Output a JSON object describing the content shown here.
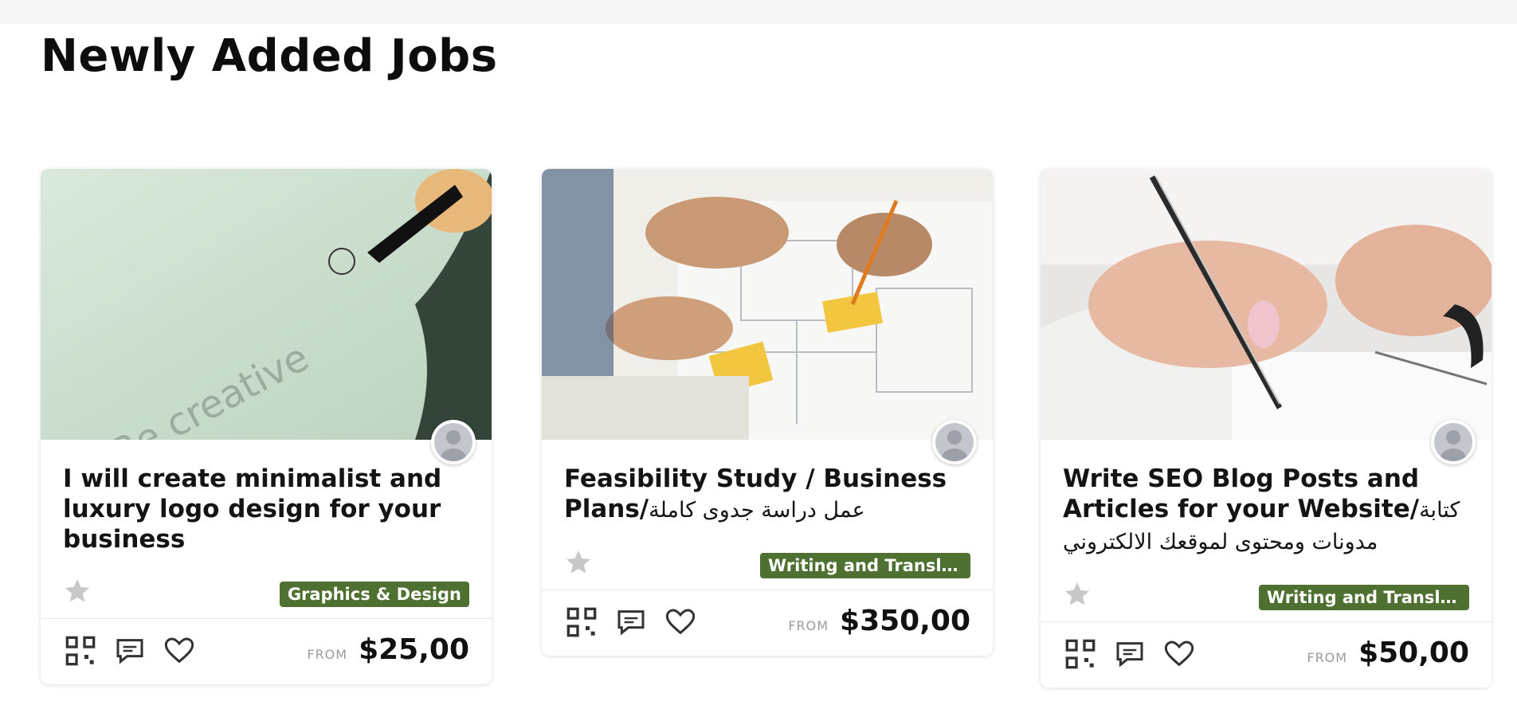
{
  "section": {
    "title": "Newly Added Jobs"
  },
  "cards": [
    {
      "title": "I will create minimalist and luxury logo design for your business",
      "image_text": "Be creative",
      "category": "Graphics & Design",
      "from_label": "FROM",
      "price": "$25,00"
    },
    {
      "title_main": "Feasibility Study / Business Plans/",
      "title_rtl": "عمل دراسة جدوى كاملة",
      "category": "Writing and Translati...",
      "from_label": "FROM",
      "price": "$350,00"
    },
    {
      "title_main": "Write SEO Blog Posts and Articles for your Website/",
      "title_rtl": "كتابة مدونات ومحتوى لموقعك الالكتروني",
      "category": "Writing and Translati...",
      "from_label": "FROM",
      "price": "$50,00"
    }
  ],
  "colors": {
    "badge": "#4e7131",
    "star": "#c8c8c8",
    "icon": "#333333"
  },
  "icons": [
    "qr-code-icon",
    "chat-icon",
    "heart-icon",
    "star-icon",
    "avatar-icon"
  ]
}
